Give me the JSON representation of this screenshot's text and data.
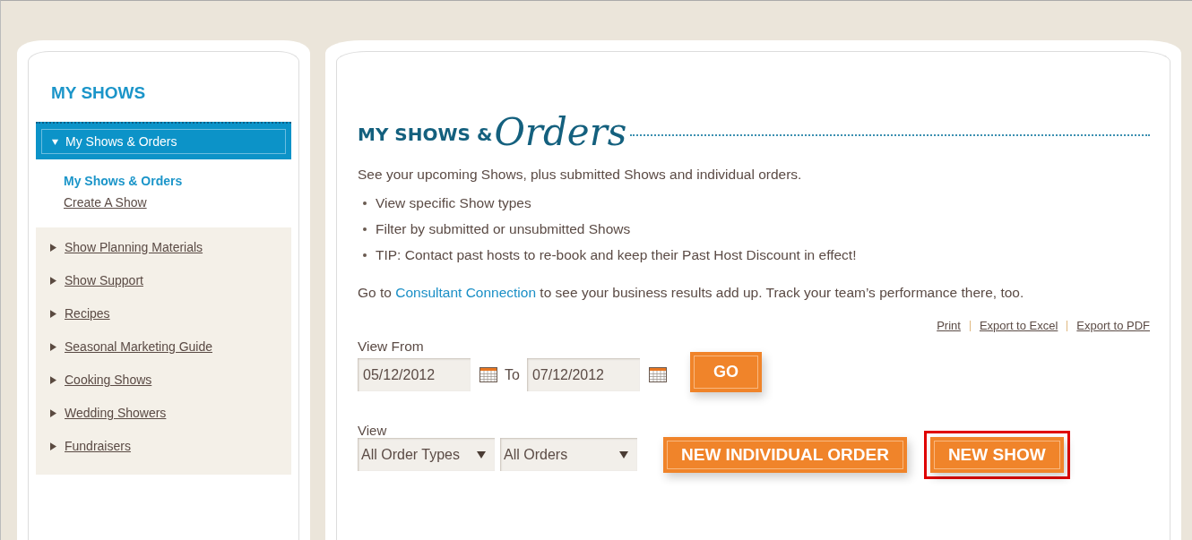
{
  "sidebar": {
    "title": "MY SHOWS",
    "active_section": {
      "label": "My Shows & Orders",
      "expanded": true
    },
    "subitems": [
      {
        "label": "My Shows & Orders",
        "selected": true
      },
      {
        "label": "Create A Show",
        "selected": false
      }
    ],
    "items": [
      {
        "label": "Show Planning Materials"
      },
      {
        "label": "Show Support"
      },
      {
        "label": "Recipes"
      },
      {
        "label": "Seasonal Marketing Guide"
      },
      {
        "label": "Cooking Shows"
      },
      {
        "label": "Wedding Showers"
      },
      {
        "label": "Fundraisers"
      }
    ]
  },
  "main": {
    "heading": {
      "prefix": "MY SHOWS &",
      "script": "Orders"
    },
    "intro": "See your upcoming Shows, plus submitted Shows and individual orders.",
    "bullets": [
      "View specific Show types",
      "Filter by submitted or unsubmitted Shows",
      "TIP: Contact past hosts to re-book and keep their Past Host Discount in effect!"
    ],
    "note": {
      "before": "Go to",
      "link": "Consultant Connection",
      "after": "to see your business results add up. Track your team’s performance there, too."
    },
    "actions": [
      "Print",
      "Export to Excel",
      "Export to PDF"
    ],
    "view_from": {
      "label": "View From",
      "from": "05/12/2012",
      "to_label": "To",
      "to": "07/12/2012",
      "button": "GO"
    },
    "view": {
      "label": "View",
      "selects": [
        "All Order Types",
        "All Orders"
      ]
    },
    "buttons": [
      {
        "label": "NEW INDIVIDUAL ORDER",
        "highlighted": false
      },
      {
        "label": "NEW SHOW",
        "highlighted": true
      }
    ]
  }
}
